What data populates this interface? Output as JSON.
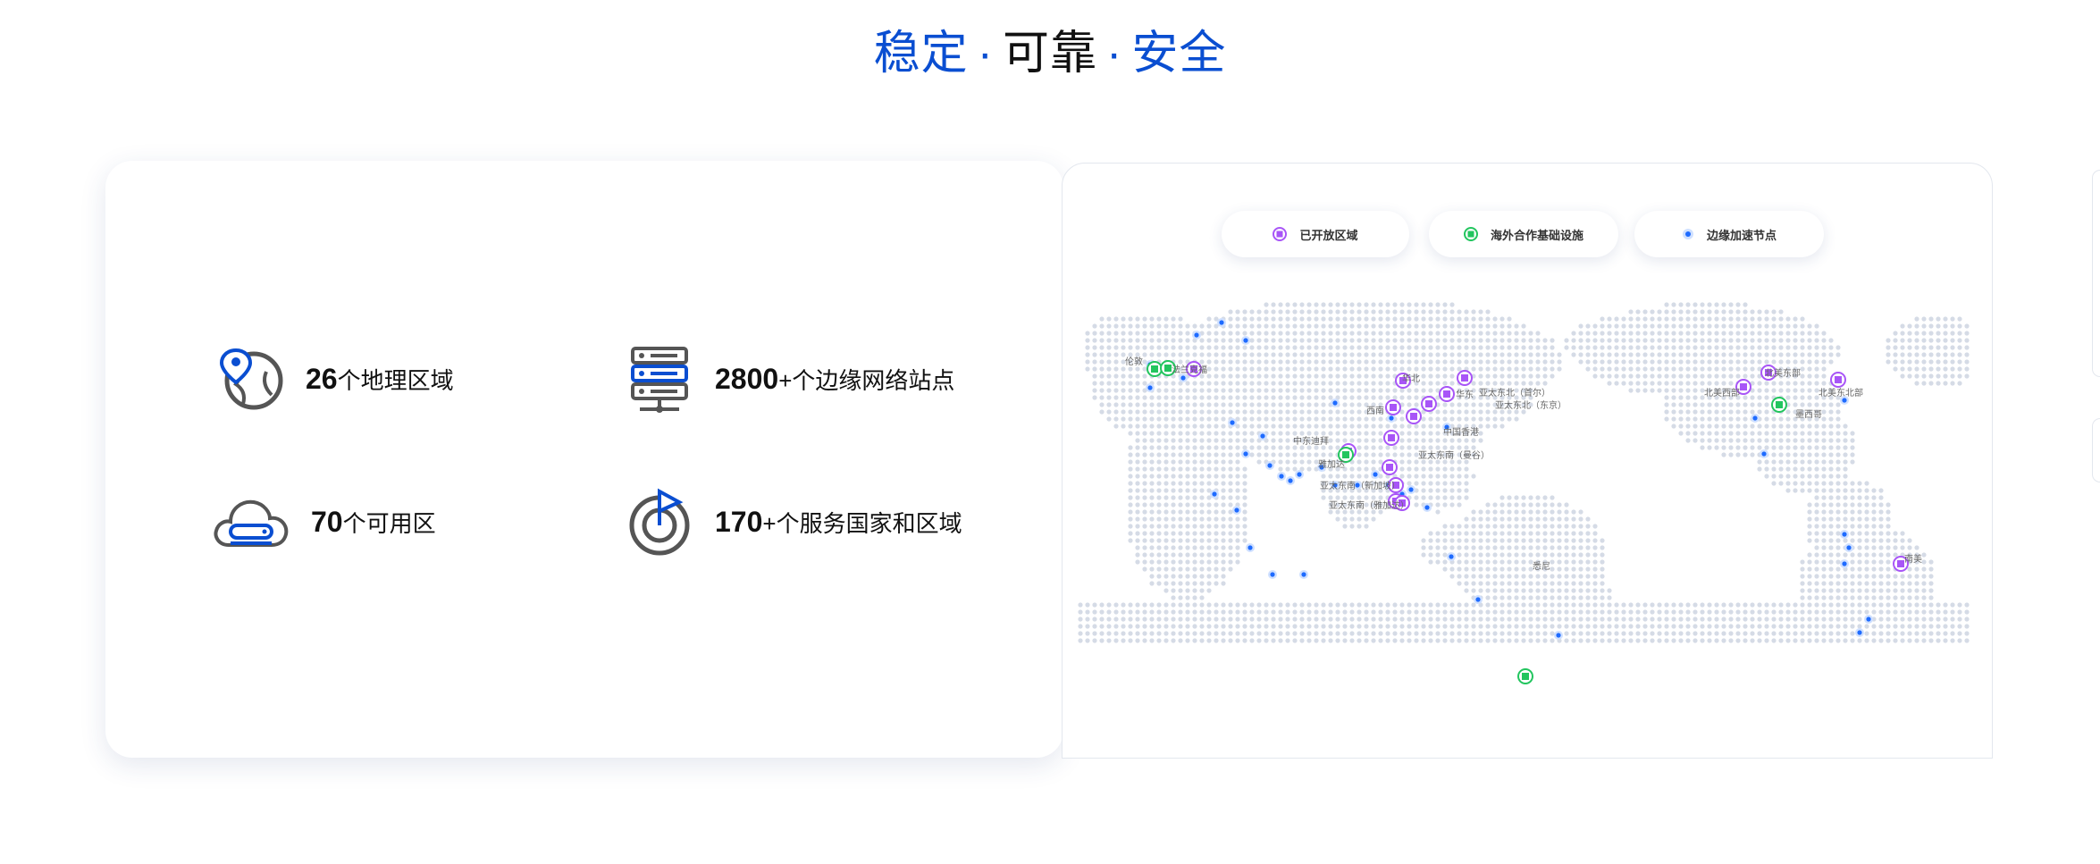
{
  "header": {
    "word1": "稳定",
    "sep1": "·",
    "word2": "可靠",
    "sep2": "·",
    "word3": "安全"
  },
  "stats": [
    {
      "number": "26",
      "label": "个地理区域",
      "icon": "globe-pin-icon"
    },
    {
      "number": "2800",
      "label": "+个边缘网络站点",
      "icon": "server-stack-icon"
    },
    {
      "number": "70",
      "label": "个可用区",
      "icon": "cloud-storage-icon"
    },
    {
      "number": "170",
      "label": "+个服务国家和区域",
      "icon": "radar-flag-icon"
    }
  ],
  "legend": {
    "region": "已开放区域",
    "partner": "海外合作基础设施",
    "edge": "边缘加速节点"
  },
  "map_labels": {
    "london": "伦敦",
    "frankfurt": "法兰克福",
    "north_china": "华北",
    "east_china": "华东",
    "south_china": "华南",
    "southwest": "西南",
    "hongkong": "中国香港",
    "ap_ne_seoul": "亚太东北（首尔）",
    "ap_ne_tokyo": "亚太东北（东京）",
    "middle_east": "中东迪拜",
    "jakarta": "雅加达",
    "ap_se_singapore": "亚太东南（新加坡）",
    "ap_se_bangkok": "亚太东南（曼谷）",
    "ap_se_manila": "亚太东南（雅加达）",
    "sydney": "悉尼",
    "us_east": "北美东部",
    "us_west": "北美西部",
    "na_ne": "北美东北部",
    "mexico": "墨西哥",
    "brazil": "南美"
  },
  "colors": {
    "accent": "#0a4ed1",
    "region": "#a855f7",
    "partner": "#22c55e",
    "edge": "#1e6bff",
    "dots": "#d5dbe6"
  }
}
